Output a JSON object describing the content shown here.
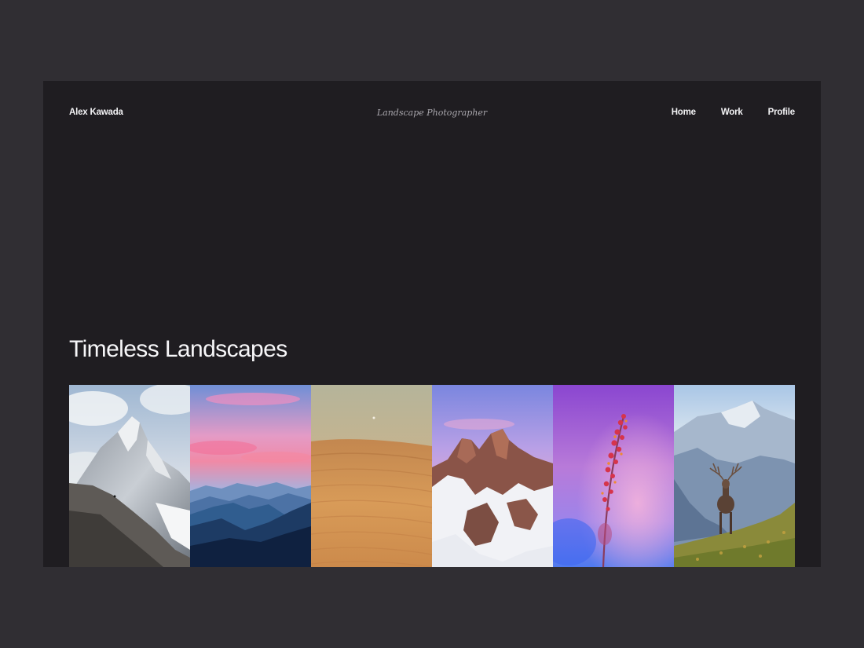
{
  "header": {
    "brand": "Alex Kawada",
    "tagline": "Landscape Photographer",
    "nav": [
      {
        "label": "Home"
      },
      {
        "label": "Work"
      },
      {
        "label": "Profile"
      }
    ]
  },
  "main": {
    "title": "Timeless Landscapes"
  },
  "gallery": {
    "photos": [
      {
        "subject": "snowy-mountain-peak"
      },
      {
        "subject": "sunset-blue-mountains"
      },
      {
        "subject": "sand-dunes"
      },
      {
        "subject": "snowy-rock-summit"
      },
      {
        "subject": "flower-stem-purple"
      },
      {
        "subject": "deer-in-mountains"
      }
    ]
  },
  "colors": {
    "page_background": "#302e33",
    "site_background": "#1f1d21",
    "text_primary": "#f3f3f5",
    "text_muted": "#a9a7ad"
  }
}
